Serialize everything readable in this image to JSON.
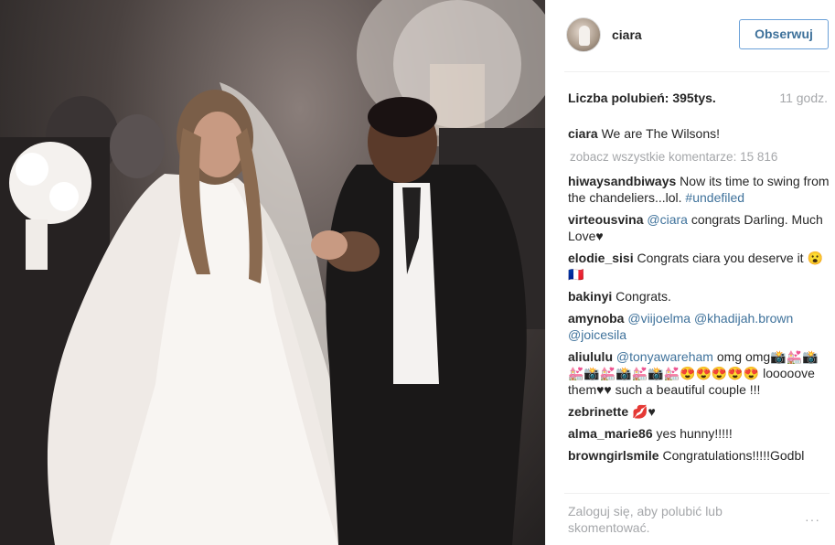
{
  "post": {
    "image_alt": "wedding photo",
    "username": "ciara",
    "follow_label": "Obserwuj",
    "likes": "Liczba polubień: 395tys.",
    "time": "11 godz.",
    "caption_user": "ciara",
    "caption_text": "We are The Wilsons!",
    "see_all_comments": "zobacz wszystkie komentarze: 15 816"
  },
  "comments": [
    {
      "user": "hiwaysandbiways",
      "text": "Now its time to swing from the chandeliers...lol.",
      "hashtag": "#undefiled"
    },
    {
      "user": "virteousvina",
      "mention": "@ciara",
      "text": "congrats Darling. Much Love♥"
    },
    {
      "user": "elodie_sisi",
      "text": "Congrats ciara you deserve it",
      "emoji": "😮🇫🇷"
    },
    {
      "user": "bakinyi",
      "text": "Congrats."
    },
    {
      "user": "amynoba",
      "mention1": "@viijoelma",
      "mention2": "@khadijah.brown",
      "mention3": "@joicesila"
    },
    {
      "user": "aliululu",
      "mention": "@tonyawareham",
      "text1": "omg",
      "text2": "omg📸💒📸💒📸💒📸💒📸💒😍😍😍😍😍",
      "text3": "looooove them♥♥ such a beautiful couple !!!"
    },
    {
      "user": "zebrinette",
      "emoji": "💋♥"
    },
    {
      "user": "alma_marie86",
      "text": "yes hunny!!!!!"
    },
    {
      "user": "browngirlsmile",
      "text": "Congratulations!!!!!Godbl"
    }
  ],
  "footer": {
    "prompt": "Zaloguj się, aby polubić lub skomentować.",
    "more_icon": "more-options-icon",
    "more_glyph": "···"
  },
  "colors": {
    "link": "#3f729b",
    "muted": "#a5a7aa",
    "text": "#262626"
  }
}
